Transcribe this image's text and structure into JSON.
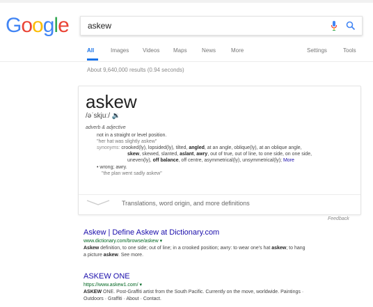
{
  "logo": {
    "letters": [
      "G",
      "o",
      "o",
      "g",
      "l",
      "e"
    ],
    "colors": [
      "#4285f4",
      "#ea4335",
      "#fbbc05",
      "#4285f4",
      "#34a853",
      "#ea4335"
    ]
  },
  "search": {
    "value": "askew"
  },
  "tabs": [
    {
      "label": "All",
      "active": true
    },
    {
      "label": "Images"
    },
    {
      "label": "Videos"
    },
    {
      "label": "Maps"
    },
    {
      "label": "News"
    },
    {
      "label": "More"
    },
    {
      "label": "Settings"
    },
    {
      "label": "Tools"
    }
  ],
  "result_stats": "About 9,640,000 results (0.94 seconds)",
  "definition": {
    "word": "askew",
    "phonetic": "/əˈskjuː/ 🔉",
    "part_of_speech": "adverb & adjective",
    "sense1": "not in a straight or level position.",
    "example1": "\"her hat was slightly askew\"",
    "synonyms_label": "synonyms:",
    "synonyms_line1": "crooked(ly), lopsided(ly), tilted,",
    "synonyms_line1_b": "angled",
    "synonyms_line1_c": ", at an angle, oblique(ly), at an oblique angle,",
    "synonyms_line2_b1": "skew",
    "synonyms_line2_a": ", skewed, slanted,",
    "synonyms_line2_b2": "aslant",
    "synonyms_line2_c": ",",
    "synonyms_line2_b3": "awry",
    "synonyms_line2_d": ", out of true, out of line, to one side, on one side,",
    "synonyms_line3_a": "uneven(ly),",
    "synonyms_line3_b": "off balance",
    "synonyms_line3_c": ", off centre, asymmetrical(ly), unsymmetrical(ly);",
    "more": "More",
    "sense2": "wrong; awry.",
    "example2": "\"the plan went sadly askew\"",
    "more_definitions": "Translations, word origin, and more definitions"
  },
  "feedback": "Feedback",
  "results": [
    {
      "title": "Askew | Define Askew at Dictionary.com",
      "url": "www.dictionary.com/browse/askew ▾",
      "snippet_b1": "Askew",
      "snippet_a": " definition, to one side; out of line; in a crooked position; awry: to wear one's hat ",
      "snippet_b2": "askew",
      "snippet_c": "; to hang",
      "snippet_line2_a": "a picture ",
      "snippet_line2_b": "askew",
      "snippet_line2_c": ". See more."
    },
    {
      "title": "ASKEW ONE",
      "url": "https://www.askew1.com/ ▾",
      "snippet_b1": "ASKEW",
      "snippet_a": " ONE. Post-Graffiti artist from the South Pacific. Currently on the move, worldwide. Paintings ·",
      "snippet_line2": "Outdoors · Graffiti · About · Contact."
    }
  ]
}
